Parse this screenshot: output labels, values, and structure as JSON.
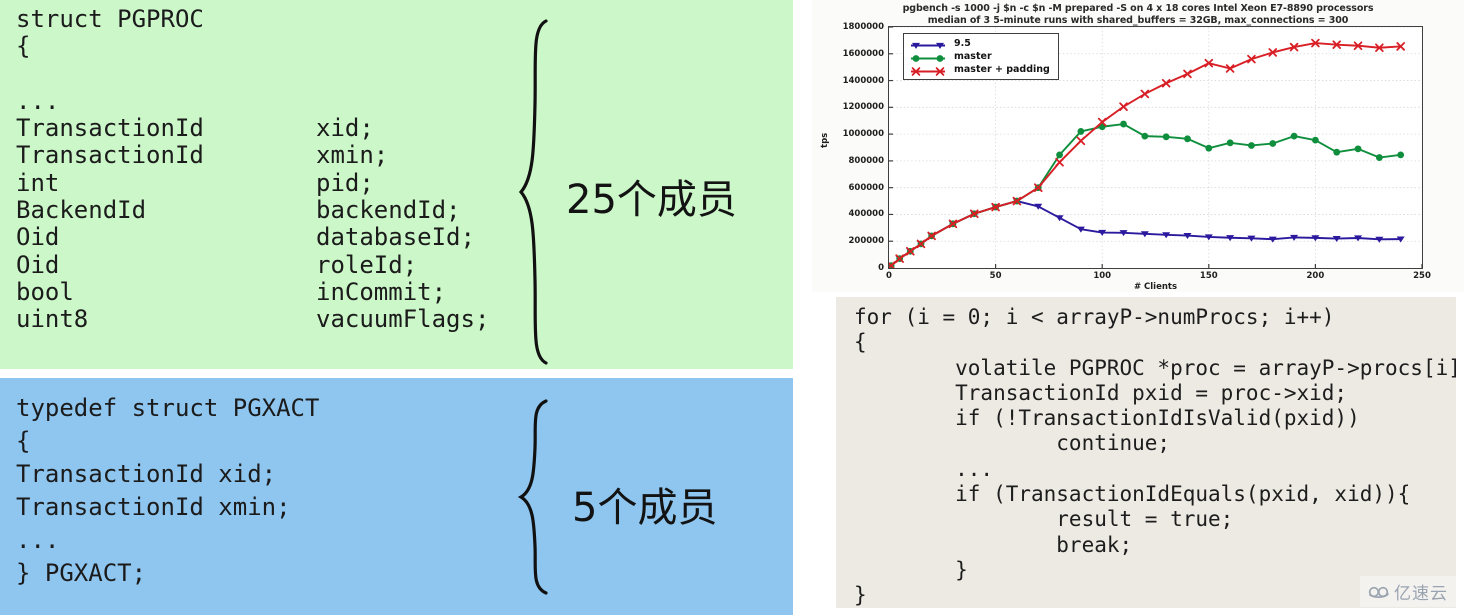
{
  "struct_panels": [
    {
      "id": "pgproc",
      "bg_color": "#cbf7c9",
      "lines": [
        {
          "type": "struct PGPROC",
          "name": ""
        },
        {
          "type": "{",
          "name": ""
        },
        {
          "type": "",
          "name": ""
        },
        {
          "type": "...",
          "name": ""
        },
        {
          "type": "TransactionId",
          "name": "xid;"
        },
        {
          "type": "TransactionId",
          "name": "xmin;"
        },
        {
          "type": "int",
          "name": "pid;"
        },
        {
          "type": "BackendId",
          "name": "backendId;"
        },
        {
          "type": "Oid",
          "name": "databaseId;"
        },
        {
          "type": "Oid",
          "name": "roleId;"
        },
        {
          "type": "bool",
          "name": "inCommit;"
        },
        {
          "type": "uint8",
          "name": "vacuumFlags;"
        },
        {
          "type": "",
          "name": ""
        },
        {
          "type": "...",
          "name": ""
        },
        {
          "type": "};",
          "name": ""
        }
      ],
      "member_count_label": "25个成员"
    },
    {
      "id": "pgxact",
      "bg_color": "#8fc6ef",
      "lines": [
        {
          "type": "typedef struct PGXACT",
          "name": ""
        },
        {
          "type": "{",
          "name": ""
        },
        {
          "type": "TransactionId xid;",
          "name": ""
        },
        {
          "type": "TransactionId xmin;",
          "name": ""
        },
        {
          "type": "...",
          "name": ""
        },
        {
          "type": "} PGXACT;",
          "name": ""
        }
      ],
      "member_count_label": "5个成员"
    }
  ],
  "chart_panel": {
    "title_line1": "pgbench -s 1000 -j $n -c $n -M prepared -S on 4 x 18 cores Intel Xeon E7-8890 processors",
    "title_line2": "median of 3 5-minute runs with shared_buffers = 32GB, max_connections = 300",
    "xlabel": "# Clients",
    "ylabel": "tps",
    "legend_position": "upper left"
  },
  "chart_data": {
    "type": "line",
    "title": "pgbench -s 1000 -j $n -c $n -M prepared -S on 4 x 18 cores Intel Xeon E7-8890 processors\nmedian of 3 5-minute runs with shared_buffers = 32GB, max_connections = 300",
    "xlabel": "# Clients",
    "ylabel": "tps",
    "xlim": [
      0,
      250
    ],
    "ylim": [
      0,
      1800000
    ],
    "xticks": [
      0,
      50,
      100,
      150,
      200,
      250
    ],
    "yticks": [
      0,
      200000,
      400000,
      600000,
      800000,
      1000000,
      1200000,
      1400000,
      1600000,
      1800000
    ],
    "grid": true,
    "legend_position": "upper left",
    "series": [
      {
        "name": "9.5",
        "color": "#2b1a9e",
        "marker": "triangle-down",
        "x": [
          1,
          5,
          10,
          15,
          20,
          30,
          40,
          50,
          60,
          70,
          80,
          90,
          100,
          110,
          120,
          130,
          140,
          150,
          160,
          170,
          180,
          190,
          200,
          210,
          220,
          230,
          240
        ],
        "y": [
          18000,
          70000,
          125000,
          180000,
          240000,
          330000,
          405000,
          455000,
          500000,
          460000,
          375000,
          290000,
          265000,
          263000,
          255000,
          248000,
          242000,
          232000,
          226000,
          222000,
          215000,
          228000,
          225000,
          220000,
          224000,
          214000,
          216000
        ]
      },
      {
        "name": "master",
        "color": "#0f8f3d",
        "marker": "circle",
        "x": [
          1,
          5,
          10,
          15,
          20,
          30,
          40,
          50,
          60,
          70,
          80,
          90,
          100,
          110,
          120,
          130,
          140,
          150,
          160,
          170,
          180,
          190,
          200,
          210,
          220,
          230,
          240
        ],
        "y": [
          18000,
          70000,
          125000,
          180000,
          240000,
          330000,
          405000,
          455000,
          500000,
          600000,
          845000,
          1020000,
          1055000,
          1075000,
          985000,
          980000,
          965000,
          895000,
          935000,
          915000,
          930000,
          985000,
          955000,
          865000,
          890000,
          825000,
          845000
        ]
      },
      {
        "name": "master + padding",
        "color": "#d81f26",
        "marker": "x",
        "x": [
          1,
          5,
          10,
          15,
          20,
          30,
          40,
          50,
          60,
          70,
          80,
          90,
          100,
          110,
          120,
          130,
          140,
          150,
          160,
          170,
          180,
          190,
          200,
          210,
          220,
          230,
          240
        ],
        "y": [
          18000,
          70000,
          125000,
          180000,
          240000,
          330000,
          405000,
          455000,
          500000,
          600000,
          790000,
          950000,
          1090000,
          1205000,
          1300000,
          1380000,
          1450000,
          1530000,
          1490000,
          1560000,
          1610000,
          1650000,
          1680000,
          1668000,
          1660000,
          1645000,
          1655000
        ]
      }
    ]
  },
  "code_panel": {
    "bg_color": "#edeae3",
    "lines": [
      "for (i = 0; i < arrayP->numProcs; i++)",
      "{",
      "        volatile PGPROC *proc = arrayP->procs[i];",
      "        TransactionId pxid = proc->xid;",
      "        if (!TransactionIdIsValid(pxid))",
      "                continue;",
      "        ...",
      "        if (TransactionIdEquals(pxid, xid)){",
      "                result = true;",
      "                break;",
      "        }",
      "}"
    ]
  },
  "watermark": {
    "text": "亿速云"
  }
}
